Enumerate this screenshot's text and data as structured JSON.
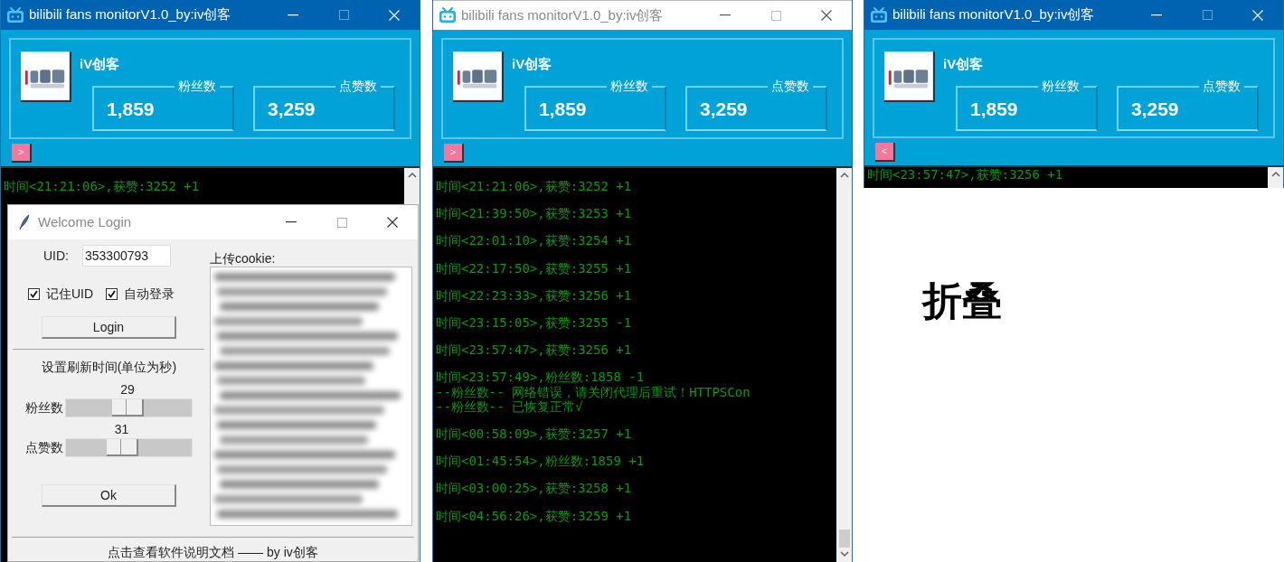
{
  "windows": [
    {
      "title": "bilibili fans monitorV1.0_by:iv创客",
      "active": true,
      "collapsed": false,
      "user_name": "iV创客",
      "stats": [
        {
          "label": "粉丝数",
          "value": "1,859"
        },
        {
          "label": "点赞数",
          "value": "3,259"
        }
      ],
      "toggle": ">",
      "log": [
        {
          "lines": [
            "时间<21:21:06>,获赞:3252 +1"
          ]
        }
      ]
    },
    {
      "title": "bilibili fans monitorV1.0_by:iv创客",
      "active": false,
      "collapsed": false,
      "user_name": "iV创客",
      "stats": [
        {
          "label": "粉丝数",
          "value": "1,859"
        },
        {
          "label": "点赞数",
          "value": "3,259"
        }
      ],
      "toggle": ">",
      "log": [
        {
          "lines": [
            "时间<21:21:06>,获赞:3252 +1"
          ]
        },
        {
          "lines": [
            "时间<21:39:50>,获赞:3253 +1"
          ]
        },
        {
          "lines": [
            "时间<22:01:10>,获赞:3254 +1"
          ]
        },
        {
          "lines": [
            "时间<22:17:50>,获赞:3255 +1"
          ]
        },
        {
          "lines": [
            "时间<22:23:33>,获赞:3256 +1"
          ]
        },
        {
          "lines": [
            "时间<23:15:05>,获赞:3255 -1"
          ]
        },
        {
          "lines": [
            "时间<23:57:47>,获赞:3256 +1"
          ]
        },
        {
          "lines": [
            "时间<23:57:49>,粉丝数:1858 -1",
            "--粉丝数-- 网络错误，请关闭代理后重试！HTTPSCon",
            "--粉丝数-- 已恢复正常√"
          ]
        },
        {
          "lines": [
            "时间<00:58:09>,获赞:3257 +1"
          ]
        },
        {
          "lines": [
            "时间<01:45:54>,粉丝数:1859 +1"
          ]
        },
        {
          "lines": [
            "时间<03:00:25>,获赞:3258 +1"
          ]
        },
        {
          "lines": [
            "时间<04:56:26>,获赞:3259 +1"
          ]
        }
      ]
    },
    {
      "title": "bilibili fans monitorV1.0_by:iv创客",
      "active": true,
      "collapsed": true,
      "user_name": "iV创客",
      "stats": [
        {
          "label": "粉丝数",
          "value": "1,859"
        },
        {
          "label": "点赞数",
          "value": "3,259"
        }
      ],
      "toggle": "<",
      "log": [
        {
          "lines": [
            "时间<23:57:47>,获赞:3256 +1"
          ]
        }
      ]
    }
  ],
  "login_dialog": {
    "title": "Welcome Login",
    "uid_label": "UID:",
    "uid_value": "353300793",
    "checkboxes": [
      {
        "label": "记住UID",
        "checked": true
      },
      {
        "label": "自动登录",
        "checked": true
      }
    ],
    "login_button": "Login",
    "refresh_heading": "设置刷新时间(单位为秒)",
    "sliders": [
      {
        "label": "粉丝数",
        "reading": "29",
        "level": 0.49
      },
      {
        "label": "点赞数",
        "reading": "31",
        "level": 0.43
      }
    ],
    "ok_button": "Ok",
    "cookie_label": "上传cookie:",
    "footer_link": "点击查看软件说明文档 —— by iv创客"
  },
  "annotation": "折叠"
}
